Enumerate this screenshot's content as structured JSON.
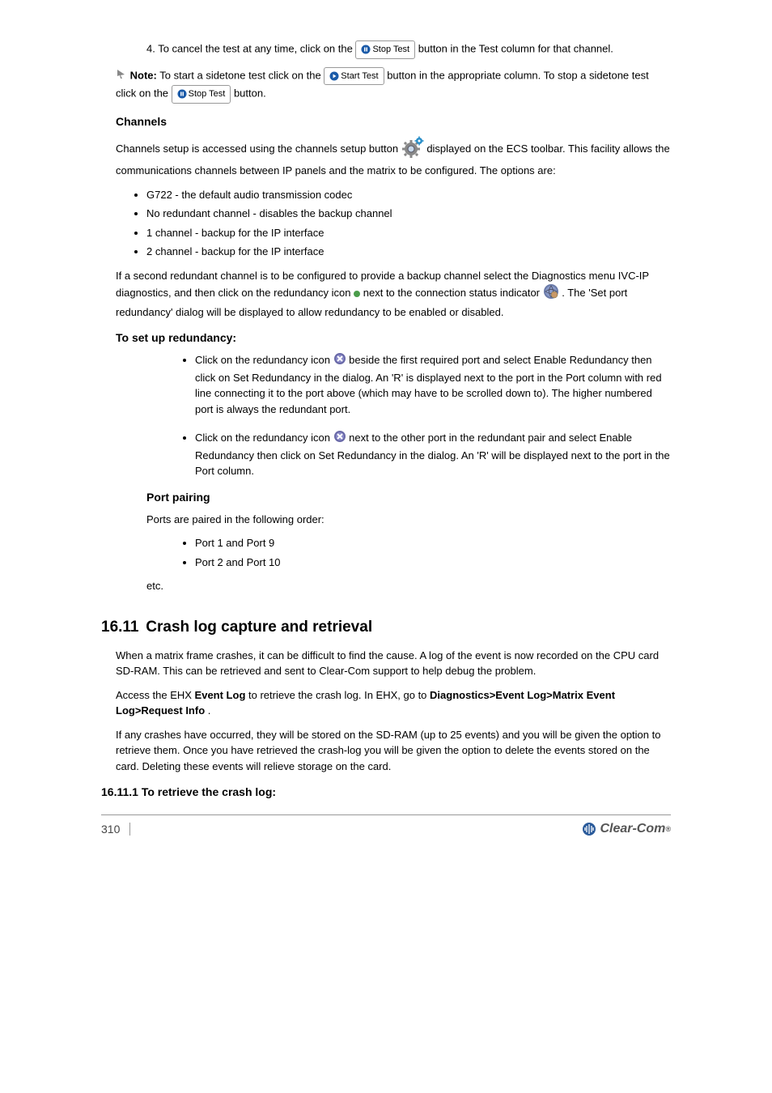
{
  "para1_prefix": "4. To cancel the test at any time, click on the ",
  "stopTest": "Stop Test",
  "para1_suffix": " button in the Test column for that channel.",
  "noteLabel": "Note:",
  "noteText": " To start a sidetone test click on the ",
  "startTest": "Start Test",
  "noteText2": " button in the appropriate column. To stop a sidetone test click on the ",
  "noteText3": " button.",
  "channelsHeading": "Channels",
  "channelsP1_prefix": "Channels setup is accessed using the channels setup button ",
  "channelsP1_suffix": " displayed on the ECS toolbar. This facility allows the communications channels between IP panels and the matrix to be configured. The options are:",
  "optG722": "G722 - the default audio transmission codec",
  "optNoRedundant": "No redundant channel - disables the backup channel",
  "opt1back": "1 channel - backup for the IP interface",
  "opt2back": "2 channel - backup for the IP interface",
  "channelsP2_prefix": "If a second redundant channel is to be configured to provide a backup channel select the Diagnostics menu IVC-IP diagnostics, and then click on the redundancy icon ",
  "channelsP2_mid": " next to the connection status indicator ",
  "channelsP2_suffix": ". The 'Set port redundancy' dialog will be displayed to allow redundancy to be enabled or disabled.",
  "redundancyHeading": "To set up redundancy:",
  "step1_prefix": "Click on the redundancy icon ",
  "step1_suffix": " beside the first required port and select Enable Redundancy then click on Set Redundancy in the dialog. An 'R' is displayed next to the port in the Port column with red line connecting it to the port above (which may have to be scrolled down to). The higher numbered port is always the redundant port.",
  "step2_prefix": "Click on the redundancy icon ",
  "step2_suffix": " next to the other port in the redundant pair and select Enable Redundancy then click on Set Redundancy in the dialog. An 'R' will be displayed next to the port in the Port column.",
  "pairingHeading": "Port pairing",
  "pairingText": "Ports are paired in the following order:",
  "pair1": "Port 1 and Port 9",
  "pair2": "Port 2 and Port 10",
  "etc": "etc.",
  "sectionNum": "16.11",
  "sectionTitle": "Crash log capture and retrieval",
  "crashP1": "When a matrix frame crashes, it can be difficult to find the cause. A log of the event is now recorded on the CPU card SD-RAM. This can be retrieved and sent to Clear-Com support to help debug the problem.",
  "crashP2_prefix": "Access the EHX ",
  "crashP2_mid1": "Event Log",
  "crashP2_mid2": " to retrieve the crash log. In EHX, go to ",
  "crashP2_mid3": "Diagnostics>Event Log>Matrix Event Log>Request Info",
  "crashP2_suffix": ".",
  "crashP3": "If any crashes have occurred, they will be stored on the SD-RAM (up to 25 events) and you will be given the option to retrieve them. Once you have retrieved the crash-log you will be given the option to delete the events stored on the card. Deleting these events will relieve storage on the card.",
  "crashHeading": "16.11.1 To retrieve the crash log:",
  "pageNum": "310"
}
